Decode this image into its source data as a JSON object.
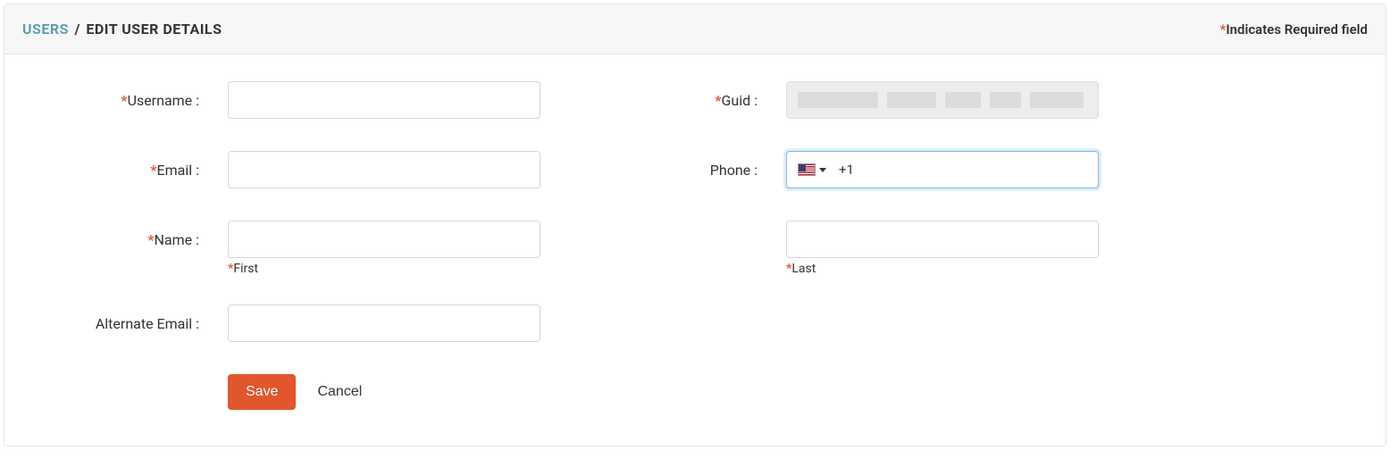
{
  "breadcrumb": {
    "root": "USERS",
    "separator": "/",
    "current": "EDIT USER DETAILS"
  },
  "required_note": {
    "asterisk": "*",
    "text": "Indicates Required field"
  },
  "labels": {
    "username": "Username :",
    "email": "Email :",
    "name": "Name :",
    "alternate_email": "Alternate Email :",
    "guid": "Guid :",
    "phone": "Phone :"
  },
  "sublabels": {
    "first": "First",
    "last": "Last"
  },
  "fields": {
    "username": "",
    "email": "",
    "first_name": "",
    "last_name": "",
    "alternate_email": "",
    "guid": "",
    "phone_number": ""
  },
  "phone": {
    "country": "US",
    "dial_code": "+1"
  },
  "buttons": {
    "save": "Save",
    "cancel": "Cancel"
  },
  "asterisk": "*"
}
